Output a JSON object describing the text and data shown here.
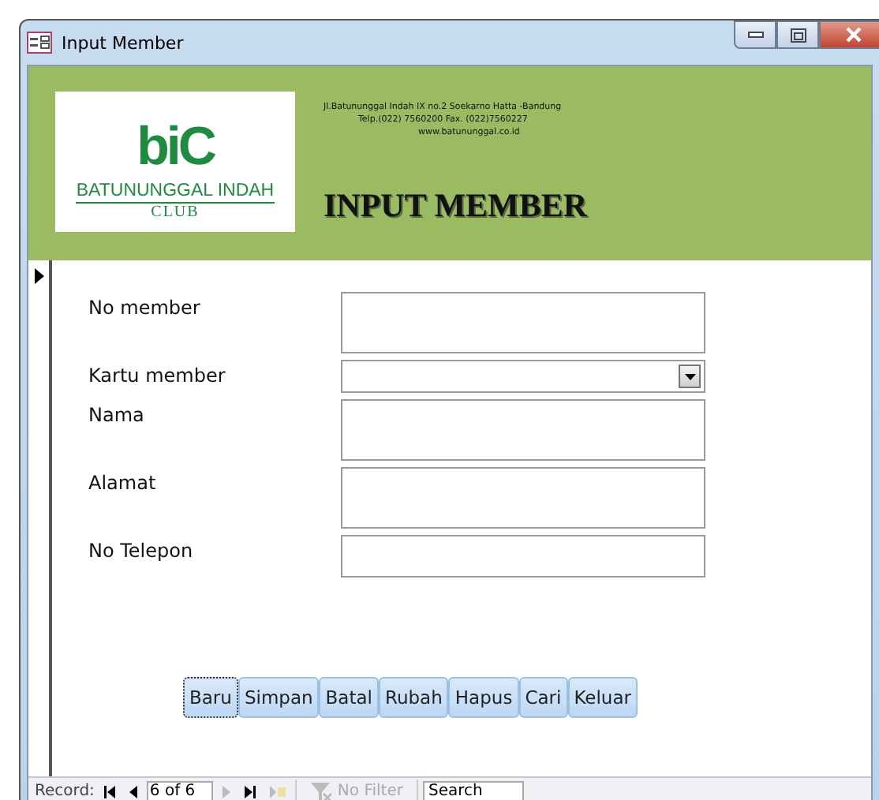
{
  "window": {
    "title": "Input Member"
  },
  "header": {
    "logo_mark": "biC",
    "logo_name": "BATUNUNGGAL INDAH",
    "logo_sub": "CLUB",
    "address_lines": [
      "Jl.Batununggal Indah IX no.2 Soekarno Hatta -Bandung",
      "Telp.(022) 7560200 Fax. (022)7560227",
      "www.batununggal.co.id"
    ],
    "title": "INPUT MEMBER"
  },
  "fields": [
    {
      "label": "No member",
      "kind": "text",
      "tall": true
    },
    {
      "label": "Kartu member",
      "kind": "combo",
      "tall": false
    },
    {
      "label": "Nama",
      "kind": "text",
      "tall": true
    },
    {
      "label": "Alamat",
      "kind": "text",
      "tall": true
    },
    {
      "label": "No Telepon",
      "kind": "text",
      "tall": false
    }
  ],
  "buttons": [
    {
      "label": "Baru",
      "focused": true
    },
    {
      "label": "Simpan",
      "focused": false
    },
    {
      "label": "Batal",
      "focused": false
    },
    {
      "label": "Rubah",
      "focused": false
    },
    {
      "label": "Hapus",
      "focused": false
    },
    {
      "label": "Cari",
      "focused": false
    },
    {
      "label": "Keluar",
      "focused": false
    }
  ],
  "navigation": {
    "label": "Record:",
    "position": "6 of 6",
    "filter": "No Filter",
    "filter_disabled": true,
    "search_placeholder": "Search"
  }
}
